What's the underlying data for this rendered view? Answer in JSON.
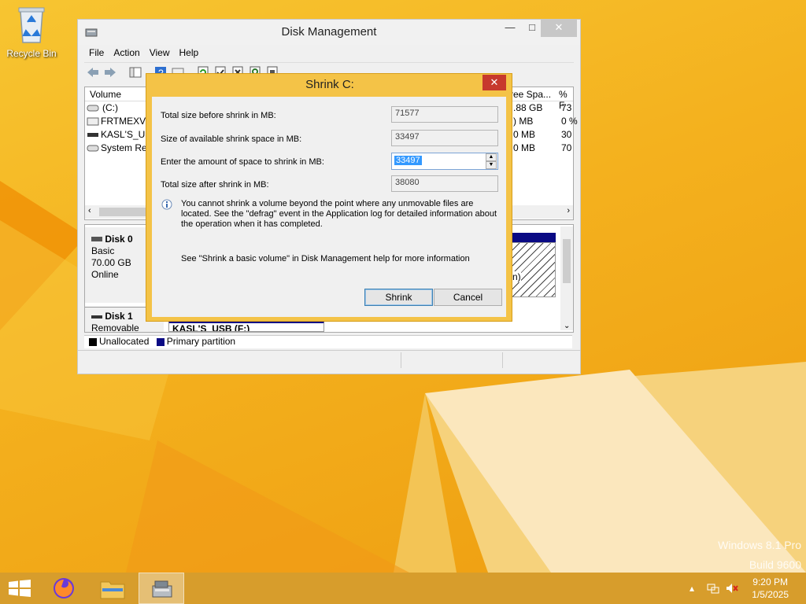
{
  "desktop": {
    "recycle_bin_label": "Recycle Bin",
    "watermark_line1": "Windows 8.1 Pro",
    "watermark_line2": "Build 9600"
  },
  "window": {
    "title": "Disk Management",
    "controls": {
      "minimize": "—",
      "maximize": "□",
      "close": "✕"
    },
    "menu": [
      "File",
      "Action",
      "View",
      "Help"
    ],
    "volume_list": {
      "headers": {
        "volume": "Volume",
        "free_space": "ree Spa...",
        "percent_free": "% F"
      },
      "rows": [
        {
          "volume": "(C:)",
          "free": ".88 GB",
          "pct": "73"
        },
        {
          "volume": "FRTMEXVO",
          "free": ") MB",
          "pct": "0 %"
        },
        {
          "volume": "KASL'S_US",
          "free": "0 MB",
          "pct": "30"
        },
        {
          "volume": "System Res",
          "free": "0 MB",
          "pct": "70"
        }
      ]
    },
    "disk0": {
      "name": "Disk 0",
      "type": "Basic",
      "size": "70.00 GB",
      "status": "Online",
      "partition_fragment": "n)"
    },
    "disk1": {
      "name": "Disk 1",
      "type": "Removable",
      "volume": "KASL'S_USB (F:)"
    },
    "legend": {
      "unallocated": "Unallocated",
      "primary": "Primary partition"
    }
  },
  "dialog": {
    "title": "Shrink C:",
    "close": "✕",
    "fields": {
      "total_before_label": "Total size before shrink in MB:",
      "total_before_value": "71577",
      "available_label": "Size of available shrink space in MB:",
      "available_value": "33497",
      "amount_label": "Enter the amount of space to shrink in MB:",
      "amount_value": "33497",
      "total_after_label": "Total size after shrink in MB:",
      "total_after_value": "38080"
    },
    "info_text": "You cannot shrink a volume beyond the point where any unmovable files are located. See the \"defrag\" event in the Application log for detailed information about the operation when it has completed.",
    "help_text": "See \"Shrink a basic volume\" in Disk Management help for more information",
    "shrink_button": "Shrink",
    "cancel_button": "Cancel"
  },
  "taskbar": {
    "time": "9:20 PM",
    "date": "1/5/2025"
  },
  "colors": {
    "accent": "#f4c347",
    "taskbar": "#d79d2c",
    "primary_partition": "#0a0a84",
    "close_red": "#c7392d"
  }
}
